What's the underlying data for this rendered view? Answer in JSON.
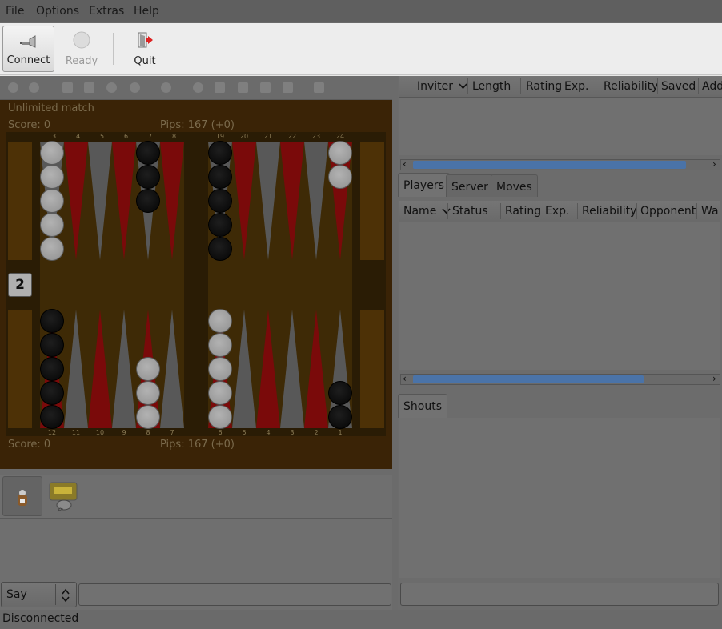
{
  "menubar": {
    "items": [
      "File",
      "Options",
      "Extras",
      "Help"
    ]
  },
  "toolbar": {
    "connect_label": "Connect",
    "ready_label": "Ready",
    "quit_label": "Quit"
  },
  "game": {
    "match_label": "Unlimited match",
    "top_score": "Score: 0",
    "top_pips": "Pips: 167 (+0)",
    "bottom_score": "Score: 0",
    "bottom_pips": "Pips: 167 (+0)",
    "cube_value": "2",
    "top_points": [
      "13",
      "14",
      "15",
      "16",
      "17",
      "18",
      "19",
      "20",
      "21",
      "22",
      "23",
      "24"
    ],
    "bottom_points": [
      "12",
      "11",
      "10",
      "9",
      "8",
      "7",
      "6",
      "5",
      "4",
      "3",
      "2",
      "1"
    ]
  },
  "chat": {
    "mode": "Say",
    "input_value": ""
  },
  "status": {
    "text": "Disconnected"
  },
  "invitations": {
    "columns": [
      "Inviter",
      "Length",
      "Rating",
      "Exp.",
      "Reliability",
      "Saved",
      "Add"
    ]
  },
  "tabs": {
    "items": [
      "Players",
      "Server",
      "Moves"
    ],
    "active": "Players"
  },
  "players": {
    "columns": [
      "Name",
      "Status",
      "Rating",
      "Exp.",
      "Reliability",
      "Opponent",
      "Wa"
    ]
  },
  "shouts": {
    "tab_label": "Shouts",
    "input_value": ""
  },
  "colors": {
    "board_frame": "#3a2306",
    "dark_point": "#7a0a0a",
    "light_point": "#585858",
    "scroll_thumb": "#4a73a8"
  }
}
